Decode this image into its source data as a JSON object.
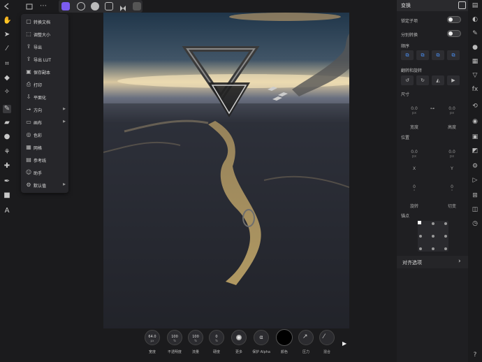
{
  "topbar": {
    "back_icon": "arrow-left-icon",
    "share_icon": "share-icon",
    "more_icon": "ellipsis-icon",
    "personas": [
      "photo-persona-icon",
      "liquify-persona-icon",
      "develop-persona-icon",
      "tone-mapping-persona-icon",
      "export-persona-icon"
    ]
  },
  "menu": {
    "items": [
      {
        "icon": "new-doc-icon",
        "label": "转换文档",
        "submenu": false
      },
      {
        "icon": "resize-icon",
        "label": "调整大小",
        "submenu": false
      },
      {
        "icon": "export-icon",
        "label": "导出",
        "submenu": false
      },
      {
        "icon": "export-lut-icon",
        "label": "导出 LUT",
        "submenu": false
      },
      {
        "icon": "save-copy-icon",
        "label": "保存副本",
        "submenu": false
      },
      {
        "icon": "print-icon",
        "label": "打印",
        "submenu": false
      },
      {
        "icon": "flatten-icon",
        "label": "平面化",
        "submenu": false
      },
      {
        "icon": "orientation-icon",
        "label": "方向",
        "submenu": true
      },
      {
        "icon": "canvas-icon",
        "label": "画布",
        "submenu": true
      },
      {
        "icon": "color-icon",
        "label": "色彩",
        "submenu": false
      },
      {
        "icon": "grid-icon",
        "label": "网格",
        "submenu": false
      },
      {
        "icon": "guides-icon",
        "label": "参考线",
        "submenu": false
      },
      {
        "icon": "assistant-icon",
        "label": "助手",
        "submenu": false
      },
      {
        "icon": "defaults-icon",
        "label": "默认值",
        "submenu": true
      }
    ]
  },
  "transform_panel": {
    "title": "变换",
    "lock_children": "锁定子项",
    "separate_transform": "分别转换",
    "order_label": "顺序",
    "flip_rotate_label": "翻转和旋转",
    "size_label": "尺寸",
    "width_value": "0.0",
    "width_unit": "px",
    "height_value": "0.0",
    "height_unit": "px",
    "width_label": "宽度",
    "height_label": "高度",
    "position_label": "位置",
    "x_value": "0.0",
    "x_unit": "px",
    "y_value": "0.0",
    "y_unit": "px",
    "x_label": "X",
    "y_label": "Y",
    "rotate_value": "0",
    "rotate_unit": "°",
    "shear_value": "0",
    "shear_unit": "°",
    "rotate_label": "旋转",
    "shear_label": "切变",
    "anchor_label": "锚点",
    "align_options": "对齐选项"
  },
  "brush": {
    "controls": [
      {
        "value": "64.0",
        "unit": "px",
        "label": "宽度"
      },
      {
        "value": "100",
        "unit": "%",
        "label": "不透明度"
      },
      {
        "value": "100",
        "unit": "%",
        "label": "流量"
      },
      {
        "value": "0",
        "unit": "%",
        "label": "硬度"
      },
      {
        "value": "",
        "unit": "",
        "label": "更多"
      },
      {
        "value": "α",
        "unit": "",
        "label": "保护 Alpha"
      },
      {
        "value": "",
        "unit": "",
        "label": "颜色"
      },
      {
        "value": "",
        "unit": "",
        "label": "压力"
      },
      {
        "value": "",
        "unit": "",
        "label": "混合"
      }
    ]
  },
  "colors": {
    "accent": "#4a8ef0",
    "persona_active": "#7b5cf0"
  }
}
